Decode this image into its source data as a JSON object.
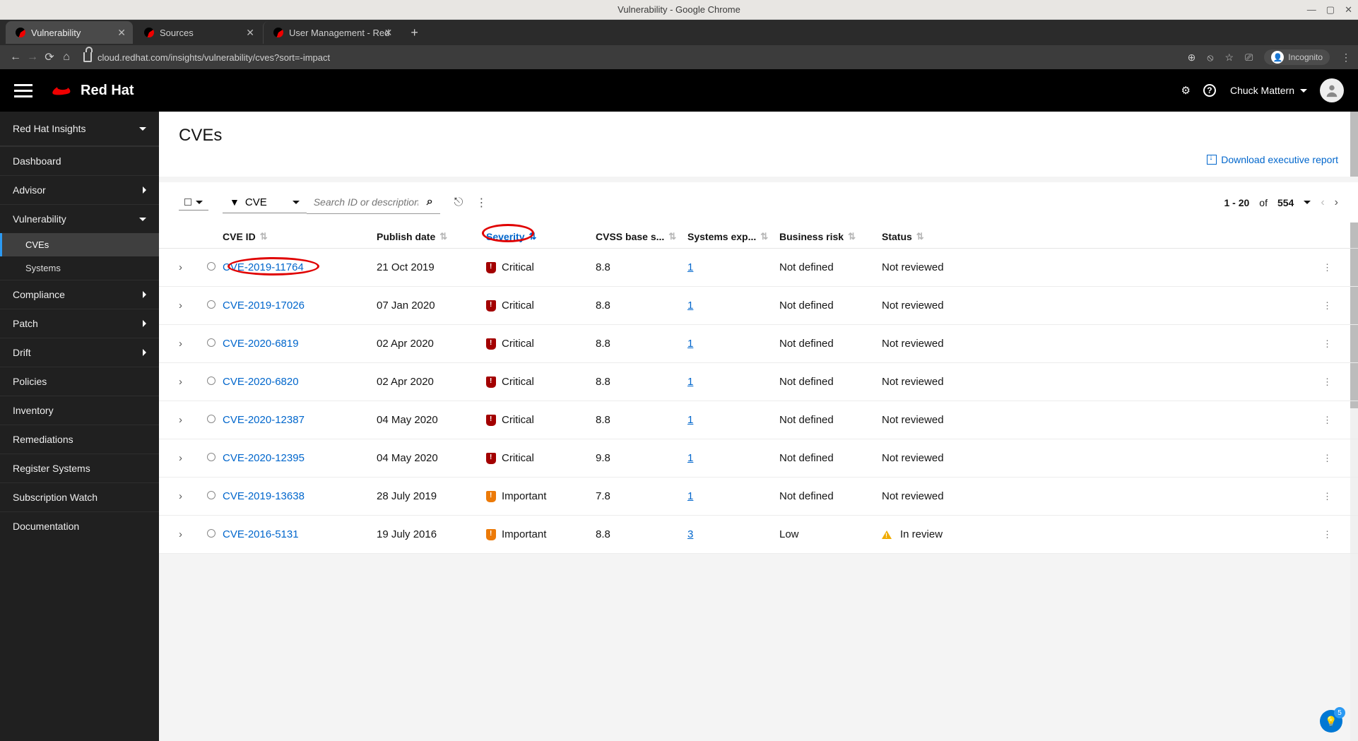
{
  "os": {
    "title": "Vulnerability - Google Chrome"
  },
  "browser": {
    "tabs": [
      {
        "title": "Vulnerability",
        "active": true
      },
      {
        "title": "Sources",
        "active": false
      },
      {
        "title": "User Management - Red",
        "active": false
      }
    ],
    "url": "cloud.redhat.com/insights/vulnerability/cves?sort=-impact",
    "incognito": "Incognito"
  },
  "header": {
    "brand": "Red Hat",
    "user": "Chuck Mattern"
  },
  "sidebar": {
    "title": "Red Hat Insights",
    "items": [
      {
        "label": "Dashboard",
        "expand": null
      },
      {
        "label": "Advisor",
        "expand": "right"
      },
      {
        "label": "Vulnerability",
        "expand": "down",
        "subs": [
          {
            "label": "CVEs",
            "active": true
          },
          {
            "label": "Systems",
            "active": false
          }
        ]
      },
      {
        "label": "Compliance",
        "expand": "right"
      },
      {
        "label": "Patch",
        "expand": "right"
      },
      {
        "label": "Drift",
        "expand": "right"
      },
      {
        "label": "Policies",
        "expand": null
      },
      {
        "label": "Inventory",
        "expand": null
      },
      {
        "label": "Remediations",
        "expand": null
      },
      {
        "label": "Register Systems",
        "expand": null
      },
      {
        "label": "Subscription Watch",
        "expand": null
      },
      {
        "label": "Documentation",
        "expand": null
      }
    ]
  },
  "page": {
    "title": "CVEs",
    "exec_report": "Download executive report",
    "filter_label": "CVE",
    "search_placeholder": "Search ID or description",
    "pager": {
      "text": "1 - 20",
      "of": "of",
      "total": "554"
    }
  },
  "columns": {
    "cve": "CVE ID",
    "date": "Publish date",
    "severity": "Severity",
    "cvss": "CVSS base s...",
    "systems": "Systems exp...",
    "risk": "Business risk",
    "status": "Status"
  },
  "rows": [
    {
      "cve": "CVE-2019-11764",
      "date": "21 Oct 2019",
      "severity": "Critical",
      "sev_level": "critical",
      "cvss": "8.8",
      "systems": "1",
      "risk": "Not defined",
      "status": "Not reviewed",
      "status_warn": false
    },
    {
      "cve": "CVE-2019-17026",
      "date": "07 Jan 2020",
      "severity": "Critical",
      "sev_level": "critical",
      "cvss": "8.8",
      "systems": "1",
      "risk": "Not defined",
      "status": "Not reviewed",
      "status_warn": false
    },
    {
      "cve": "CVE-2020-6819",
      "date": "02 Apr 2020",
      "severity": "Critical",
      "sev_level": "critical",
      "cvss": "8.8",
      "systems": "1",
      "risk": "Not defined",
      "status": "Not reviewed",
      "status_warn": false
    },
    {
      "cve": "CVE-2020-6820",
      "date": "02 Apr 2020",
      "severity": "Critical",
      "sev_level": "critical",
      "cvss": "8.8",
      "systems": "1",
      "risk": "Not defined",
      "status": "Not reviewed",
      "status_warn": false
    },
    {
      "cve": "CVE-2020-12387",
      "date": "04 May 2020",
      "severity": "Critical",
      "sev_level": "critical",
      "cvss": "8.8",
      "systems": "1",
      "risk": "Not defined",
      "status": "Not reviewed",
      "status_warn": false
    },
    {
      "cve": "CVE-2020-12395",
      "date": "04 May 2020",
      "severity": "Critical",
      "sev_level": "critical",
      "cvss": "9.8",
      "systems": "1",
      "risk": "Not defined",
      "status": "Not reviewed",
      "status_warn": false
    },
    {
      "cve": "CVE-2019-13638",
      "date": "28 July 2019",
      "severity": "Important",
      "sev_level": "important",
      "cvss": "7.8",
      "systems": "1",
      "risk": "Not defined",
      "status": "Not reviewed",
      "status_warn": false
    },
    {
      "cve": "CVE-2016-5131",
      "date": "19 July 2016",
      "severity": "Important",
      "sev_level": "important",
      "cvss": "8.8",
      "systems": "3",
      "risk": "Low",
      "status": "In review",
      "status_warn": true
    }
  ],
  "fab_badge": "5"
}
